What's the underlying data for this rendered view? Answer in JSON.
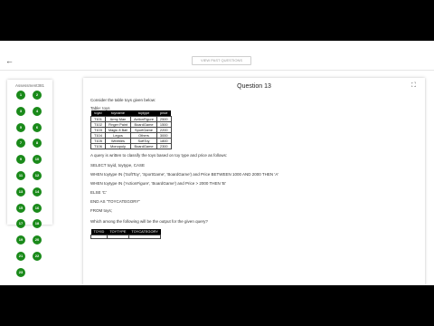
{
  "header": {
    "view_button_label": "VIEW PAST QUESTIONS"
  },
  "sidebar": {
    "title": "Assessment381",
    "buttons": [
      "1",
      "2",
      "3",
      "4",
      "5",
      "6",
      "7",
      "8",
      "9",
      "10",
      "11",
      "12",
      "13",
      "14",
      "15",
      "16",
      "17",
      "18",
      "19",
      "20",
      "21",
      "22",
      "23"
    ]
  },
  "question": {
    "title": "Question 13",
    "intro": "Consider the table toys given below:",
    "table_label": "Table: toys",
    "toys_headers": [
      "toyid",
      "toyname",
      "toytype",
      "price"
    ],
    "toys_rows": [
      [
        "T101",
        "Army Man",
        "ActionFigure",
        "2500"
      ],
      [
        "T102",
        "Finger Paint",
        "BoardGame",
        "1500"
      ],
      [
        "T103",
        "Magic 8 Ball",
        "SportGame",
        "2200"
      ],
      [
        "T104",
        "Legos",
        "Others",
        "3000"
      ],
      [
        "T105",
        "Weebles",
        "SoftToy",
        "1800"
      ],
      [
        "T106",
        "Monopoly",
        "BoardGame",
        "2300"
      ]
    ],
    "query_intro": "A query is written to classify the toys based on toy type and price as follows:",
    "query_lines": [
      "SELECT toyid, toytype, CASE",
      "WHEN toytype IN ('SoftToy', 'SportGame', 'BoardGame') and Price BETWEEN 1000 AND 2000 THEN 'A'",
      "WHEN toytype IN ('ActionFigure', 'BoardGame') and Price > 2000 THEN 'B'",
      "ELSE 'C'",
      "END AS \"TOYCATEGORY\"",
      "FROM toys;"
    ],
    "prompt": "Which among the following will be the output for the given query?",
    "output_headers": [
      "TOYID",
      "TOYTYPE",
      "TOYCATEGORY"
    ]
  }
}
